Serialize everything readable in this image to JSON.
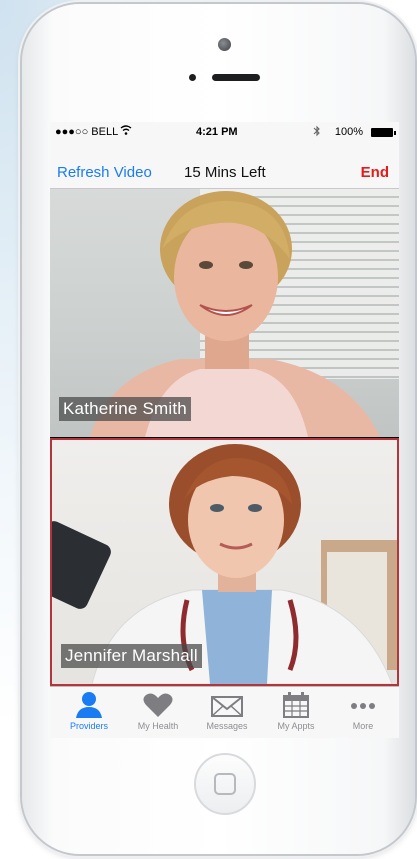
{
  "status_bar": {
    "carrier": "●●●○○ BELL",
    "time": "4:21 PM",
    "battery": "100%"
  },
  "nav": {
    "left_button": "Refresh Video",
    "title": "15 Mins Left",
    "right_button": "End"
  },
  "videos": [
    {
      "name": "Katherine Smith"
    },
    {
      "name": "Jennifer Marshall"
    }
  ],
  "tabs": [
    {
      "label": "Providers",
      "icon": "person-icon",
      "active": true
    },
    {
      "label": "My Health",
      "icon": "heart-icon",
      "active": false
    },
    {
      "label": "Messages",
      "icon": "envelope-icon",
      "active": false
    },
    {
      "label": "My Appts",
      "icon": "calendar-icon",
      "active": false
    },
    {
      "label": "More",
      "icon": "more-icon",
      "active": false
    }
  ],
  "colors": {
    "accent": "#1a7cf2",
    "end": "#e31b1b",
    "active_frame": "#b3343a"
  }
}
